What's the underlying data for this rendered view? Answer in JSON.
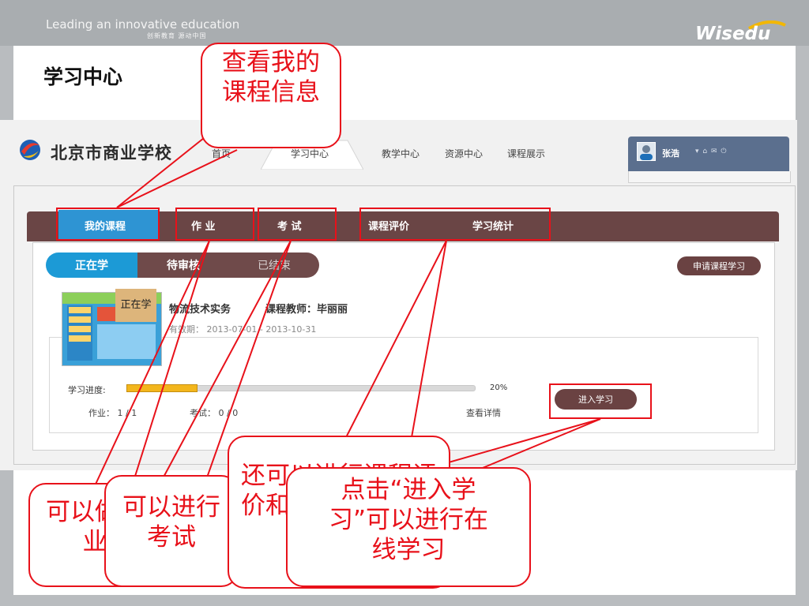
{
  "slide": {
    "slogan_en": "Leading an innovative education",
    "slogan_cn": "创新教育 源动中国",
    "brand": "Wisedu",
    "title": "学习中心"
  },
  "portal": {
    "school_name": "北京市商业学校",
    "nav": [
      "首页",
      "学习中心",
      "教学中心",
      "资源中心",
      "课程展示"
    ],
    "user": {
      "name": "张浩",
      "icons": "▾ ⌂ ✉ ⏻"
    },
    "tabs": [
      "我的课程",
      "作 业",
      "考 试",
      "课程评价",
      "学习统计"
    ],
    "status_tabs": [
      "正在学",
      "待审核",
      "已结束"
    ],
    "apply_button": "申请课程学习",
    "course": {
      "badge": "正在学",
      "title": "物流技术实务",
      "teacher": "课程教师：毕丽丽",
      "validity": "有效期： 2013-07-01 - 2013-10-31",
      "progress_label": "学习进度:",
      "progress": 0.2,
      "progress_text": "20%",
      "enter_button": "进入学习",
      "homework": "作业： 1 / 1",
      "exam": "考试： 0 / 0",
      "detail_link": "查看详情"
    }
  },
  "annotations": {
    "view_course": "查看我的课程信息",
    "homework": "可以做作业",
    "exam": "可以进行考试",
    "evaluate": "还可以进行课程评价和查看学习统计",
    "enter": "点击“进入学习”可以进行在线学习"
  },
  "colors": {
    "annotation_red": "#e8111a",
    "tab_active": "#2e94d3",
    "tab_bar": "#6a4545",
    "progress": "#f3b61c"
  }
}
